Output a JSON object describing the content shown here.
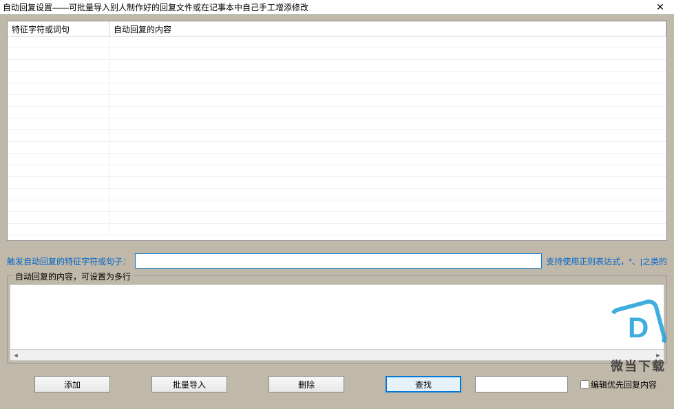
{
  "window": {
    "title": "自动回复设置——可批量导入别人制作好的回复文件或在记事本中自己手工增添修改"
  },
  "table": {
    "col1": "特征字符或词句",
    "col2": "自动回复的内容"
  },
  "trigger": {
    "label": "触发自动回复的特征字符或句子：",
    "value": "",
    "hint": "支持使用正则表达式，*、|之类的"
  },
  "content": {
    "legend": "自动回复的内容，可设置为多行",
    "value": ""
  },
  "buttons": {
    "add": "添加",
    "import": "批量导入",
    "delete": "删除",
    "find": "查找",
    "find_value": "",
    "checkbox_label": "编辑优先回复内容"
  },
  "watermark": {
    "text": "微当下载",
    "sub": ""
  }
}
